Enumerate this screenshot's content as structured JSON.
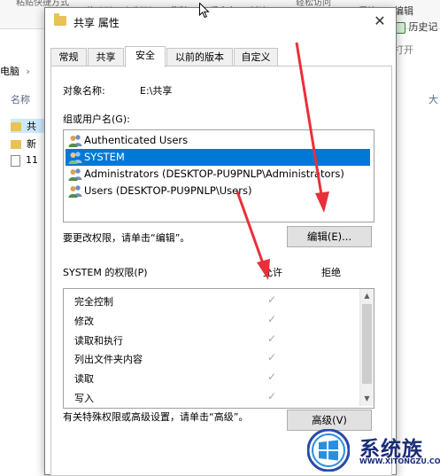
{
  "explorer": {
    "ribbon_top_clipped": [
      "粘贴快捷方式",
      "轻松访问"
    ],
    "ribbon_buttons": [
      "移动到",
      "复制到",
      "删除",
      "重命名",
      "新建",
      "属性"
    ],
    "ribbon_right": {
      "edit": "编辑",
      "history": "历史记",
      "open_group": "打开"
    },
    "address": "电脑",
    "address_chevron": "›",
    "column_name": "名称",
    "column_right": "大",
    "nav_items": [
      "共",
      "新",
      "11"
    ]
  },
  "dialog": {
    "title": "共享 属性",
    "close_glyph": "✕",
    "tabs": [
      "常规",
      "共享",
      "安全",
      "以前的版本",
      "自定义"
    ],
    "active_tab": "安全",
    "object_name_label": "对象名称:",
    "object_name_value": "E:\\共享",
    "groups_label": "组或用户名(G):",
    "users": [
      "Authenticated Users",
      "SYSTEM",
      "Administrators (DESKTOP-PU9PNLP\\Administrators)",
      "Users (DESKTOP-PU9PNLP\\Users)"
    ],
    "selected_user": "SYSTEM",
    "change_hint": "要更改权限，请单击“编辑”。",
    "edit_button": "编辑(E)...",
    "perm_header": "SYSTEM 的权限(P)",
    "allow_header": "允许",
    "deny_header": "拒绝",
    "permissions": [
      {
        "name": "完全控制",
        "allow": "✓"
      },
      {
        "name": "修改",
        "allow": "✓"
      },
      {
        "name": "读取和执行",
        "allow": "✓"
      },
      {
        "name": "列出文件夹内容",
        "allow": "✓"
      },
      {
        "name": "读取",
        "allow": "✓"
      },
      {
        "name": "写入",
        "allow": "✓"
      }
    ],
    "advanced_hint": "有关特殊权限或高级设置，请单击“高级”。",
    "advanced_button": "高级(V)"
  },
  "watermark": {
    "text": "系统族",
    "url": "WWW.XITONGZU.COM"
  },
  "colors": {
    "selection": "#0078d7",
    "annotation_arrow": "#e8303a",
    "check_gray": "#a6a6a6"
  },
  "icons": [
    "folder-icon",
    "close-icon",
    "users-icon",
    "checkmark-icon",
    "scroll-up-icon",
    "scroll-down-icon",
    "windows-logo-icon",
    "cursor-icon",
    "history-icon"
  ]
}
